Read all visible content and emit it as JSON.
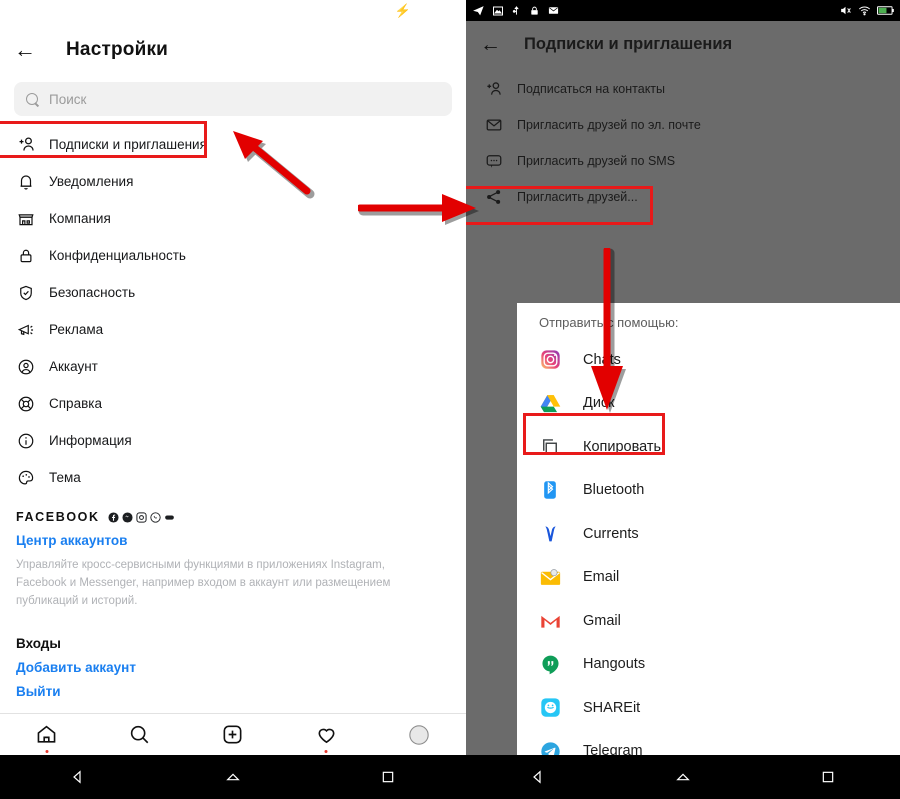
{
  "left_phone": {
    "status_bar": {
      "charging_icon": "lightning-bolt-icon"
    },
    "appbar": {
      "back_icon": "back-arrow-icon",
      "title": "Настройки"
    },
    "search": {
      "icon": "search-icon",
      "placeholder": "Поиск",
      "value": ""
    },
    "menu_items": [
      {
        "icon": "add-person-icon",
        "label": "Подписки и приглашения",
        "highlighted": true
      },
      {
        "icon": "bell-icon",
        "label": "Уведомления"
      },
      {
        "icon": "store-icon",
        "label": "Компания"
      },
      {
        "icon": "lock-icon",
        "label": "Конфиденциальность"
      },
      {
        "icon": "shield-check-icon",
        "label": "Безопасность"
      },
      {
        "icon": "megaphone-icon",
        "label": "Реклама"
      },
      {
        "icon": "account-circle-icon",
        "label": "Аккаунт"
      },
      {
        "icon": "lifebuoy-icon",
        "label": "Справка"
      },
      {
        "icon": "info-icon",
        "label": "Информация"
      },
      {
        "icon": "palette-icon",
        "label": "Тема"
      }
    ],
    "facebook_section": {
      "title": "FACEBOOK",
      "brand_icons": [
        "facebook-icon",
        "messenger-icon",
        "instagram-icon",
        "whatsapp-icon",
        "portal-icon"
      ],
      "accounts_center_link": "Центр аккаунтов",
      "description": "Управляйте кросс-сервисными функциями в приложениях Instagram, Facebook и Messenger, например входом в аккаунт или размещением публикаций и историй.",
      "logins_heading": "Входы",
      "add_account_link": "Добавить аккаунт",
      "logout_link": "Выйти"
    },
    "tabbar": [
      {
        "icon": "home-icon",
        "badge": true
      },
      {
        "icon": "search-icon",
        "badge": false
      },
      {
        "icon": "add-post-icon",
        "badge": false
      },
      {
        "icon": "heart-icon",
        "badge": true
      },
      {
        "icon": "profile-avatar-icon",
        "badge": false
      }
    ],
    "navbar": [
      {
        "icon": "android-back-icon"
      },
      {
        "icon": "android-home-icon"
      },
      {
        "icon": "android-recents-icon"
      }
    ]
  },
  "right_phone": {
    "status_bar": {
      "left_icons": [
        "telegram-icon",
        "screenshot-icon",
        "usb-icon",
        "lock-icon",
        "mail-icon"
      ],
      "right_icons": [
        "mute-icon",
        "wifi-icon",
        "battery-icon"
      ]
    },
    "appbar": {
      "back_icon": "back-arrow-icon",
      "title": "Подписки и приглашения"
    },
    "menu_items": [
      {
        "icon": "add-person-icon",
        "label": "Подписаться на контакты",
        "highlighted": false
      },
      {
        "icon": "mail-icon",
        "label": "Пригласить друзей по эл. почте",
        "highlighted": false
      },
      {
        "icon": "sms-icon",
        "label": "Пригласить друзей по SMS",
        "highlighted": false
      },
      {
        "icon": "share-icon",
        "label": "Пригласить друзей...",
        "highlighted": true
      }
    ],
    "share_sheet": {
      "title": "Отправить с помощью:",
      "items": [
        {
          "icon": "instagram-icon",
          "label": "Chats",
          "highlighted": false
        },
        {
          "icon": "google-drive-icon",
          "label": "Диск",
          "highlighted": false
        },
        {
          "icon": "copy-icon",
          "label": "Копировать",
          "highlighted": true
        },
        {
          "icon": "bluetooth-icon",
          "label": "Bluetooth",
          "highlighted": false
        },
        {
          "icon": "currents-icon",
          "label": "Currents",
          "highlighted": false
        },
        {
          "icon": "email-icon",
          "label": "Email",
          "highlighted": false
        },
        {
          "icon": "gmail-icon",
          "label": "Gmail",
          "highlighted": false
        },
        {
          "icon": "hangouts-icon",
          "label": "Hangouts",
          "highlighted": false
        },
        {
          "icon": "shareit-icon",
          "label": "SHAREit",
          "highlighted": false
        },
        {
          "icon": "telegram-icon",
          "label": "Telegram",
          "highlighted": false
        }
      ]
    },
    "navbar": [
      {
        "icon": "android-back-icon"
      },
      {
        "icon": "android-home-icon"
      },
      {
        "icon": "android-recents-icon"
      }
    ]
  },
  "annotations": {
    "highlight_color": "#e81a1a",
    "arrows": [
      {
        "name": "arrow-to-subscriptions",
        "direction": "up-left"
      },
      {
        "name": "arrow-to-invite-friends",
        "direction": "right"
      },
      {
        "name": "arrow-to-copy",
        "direction": "down"
      }
    ]
  }
}
